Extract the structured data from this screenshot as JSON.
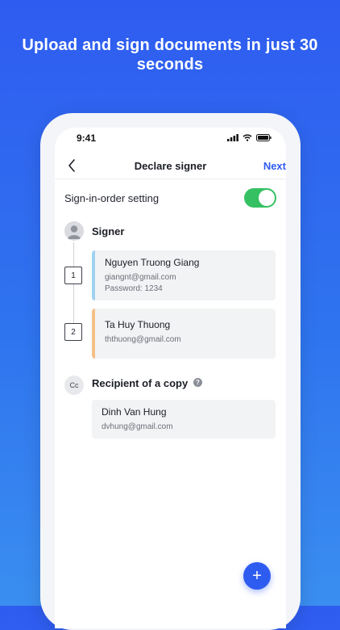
{
  "headline": "Upload and sign documents in just 30 seconds",
  "status": {
    "time": "9:41"
  },
  "nav": {
    "title": "Declare signer",
    "next_label": "Next"
  },
  "settings": {
    "sign_in_order_label": "Sign-in-order setting",
    "sign_in_order_enabled": true
  },
  "signer_section": {
    "title": "Signer",
    "signers": [
      {
        "order": "1",
        "name": "Nguyen Truong Giang",
        "email": "giangnt@gmail.com",
        "password": "Password: 1234",
        "accent": "#9fd2f0"
      },
      {
        "order": "2",
        "name": "Ta Huy Thuong",
        "email": "ththuong@gmail.com",
        "accent": "#f4c088"
      }
    ]
  },
  "copy_section": {
    "icon_text": "Cc",
    "title": "Recipient of a copy",
    "help_icon": "?",
    "recipients": [
      {
        "name": "Dinh Van Hung",
        "email": "dvhung@gmail.com"
      }
    ]
  },
  "fab": {
    "icon": "+"
  },
  "colors": {
    "brand": "#2f5cf0",
    "toggle_on": "#35c163"
  }
}
